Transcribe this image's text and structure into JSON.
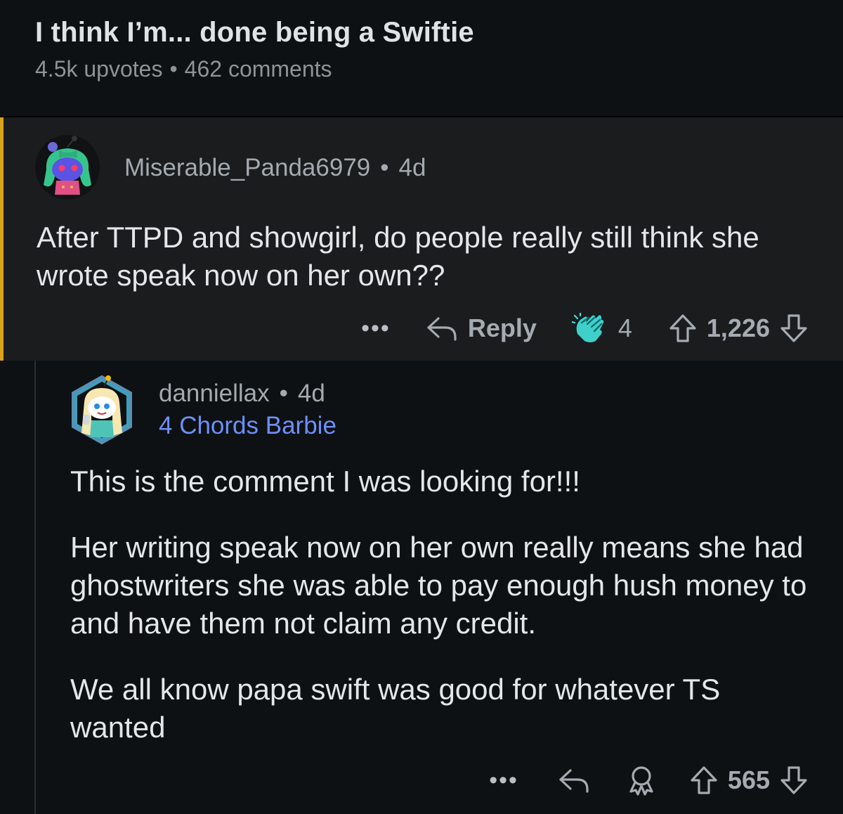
{
  "post": {
    "title": "I think I’m... done being a Swiftie",
    "upvotes": "4.5k upvotes",
    "separator": "•",
    "comments": "462 comments"
  },
  "comment1": {
    "author": "Miserable_Panda6979",
    "separator": "•",
    "age": "4d",
    "body": "After TTPD and showgirl, do people really still think she wrote speak now on her own??",
    "more": "•••",
    "reply_label": "Reply",
    "award_count": "4",
    "score": "1,226",
    "accent_color": "#d9a21b"
  },
  "comment2": {
    "author": "danniellax",
    "separator": "•",
    "age": "4d",
    "flair": "4 Chords Barbie",
    "paragraphs": [
      "This is the comment I was looking for!!!",
      "Her writing speak now on her own really means she had ghostwriters she was able to pay enough hush money to and have them not claim any credit.",
      "We all know papa swift was good for whatever TS wanted"
    ],
    "more": "•••",
    "score": "565",
    "flair_color": "#6d8ffb"
  },
  "icons": {
    "reply": "reply-arrow-icon",
    "award": "clapping-hands-icon",
    "award_outline": "award-ribbon-icon",
    "upvote": "arrow-up-icon",
    "downvote": "arrow-down-icon"
  }
}
